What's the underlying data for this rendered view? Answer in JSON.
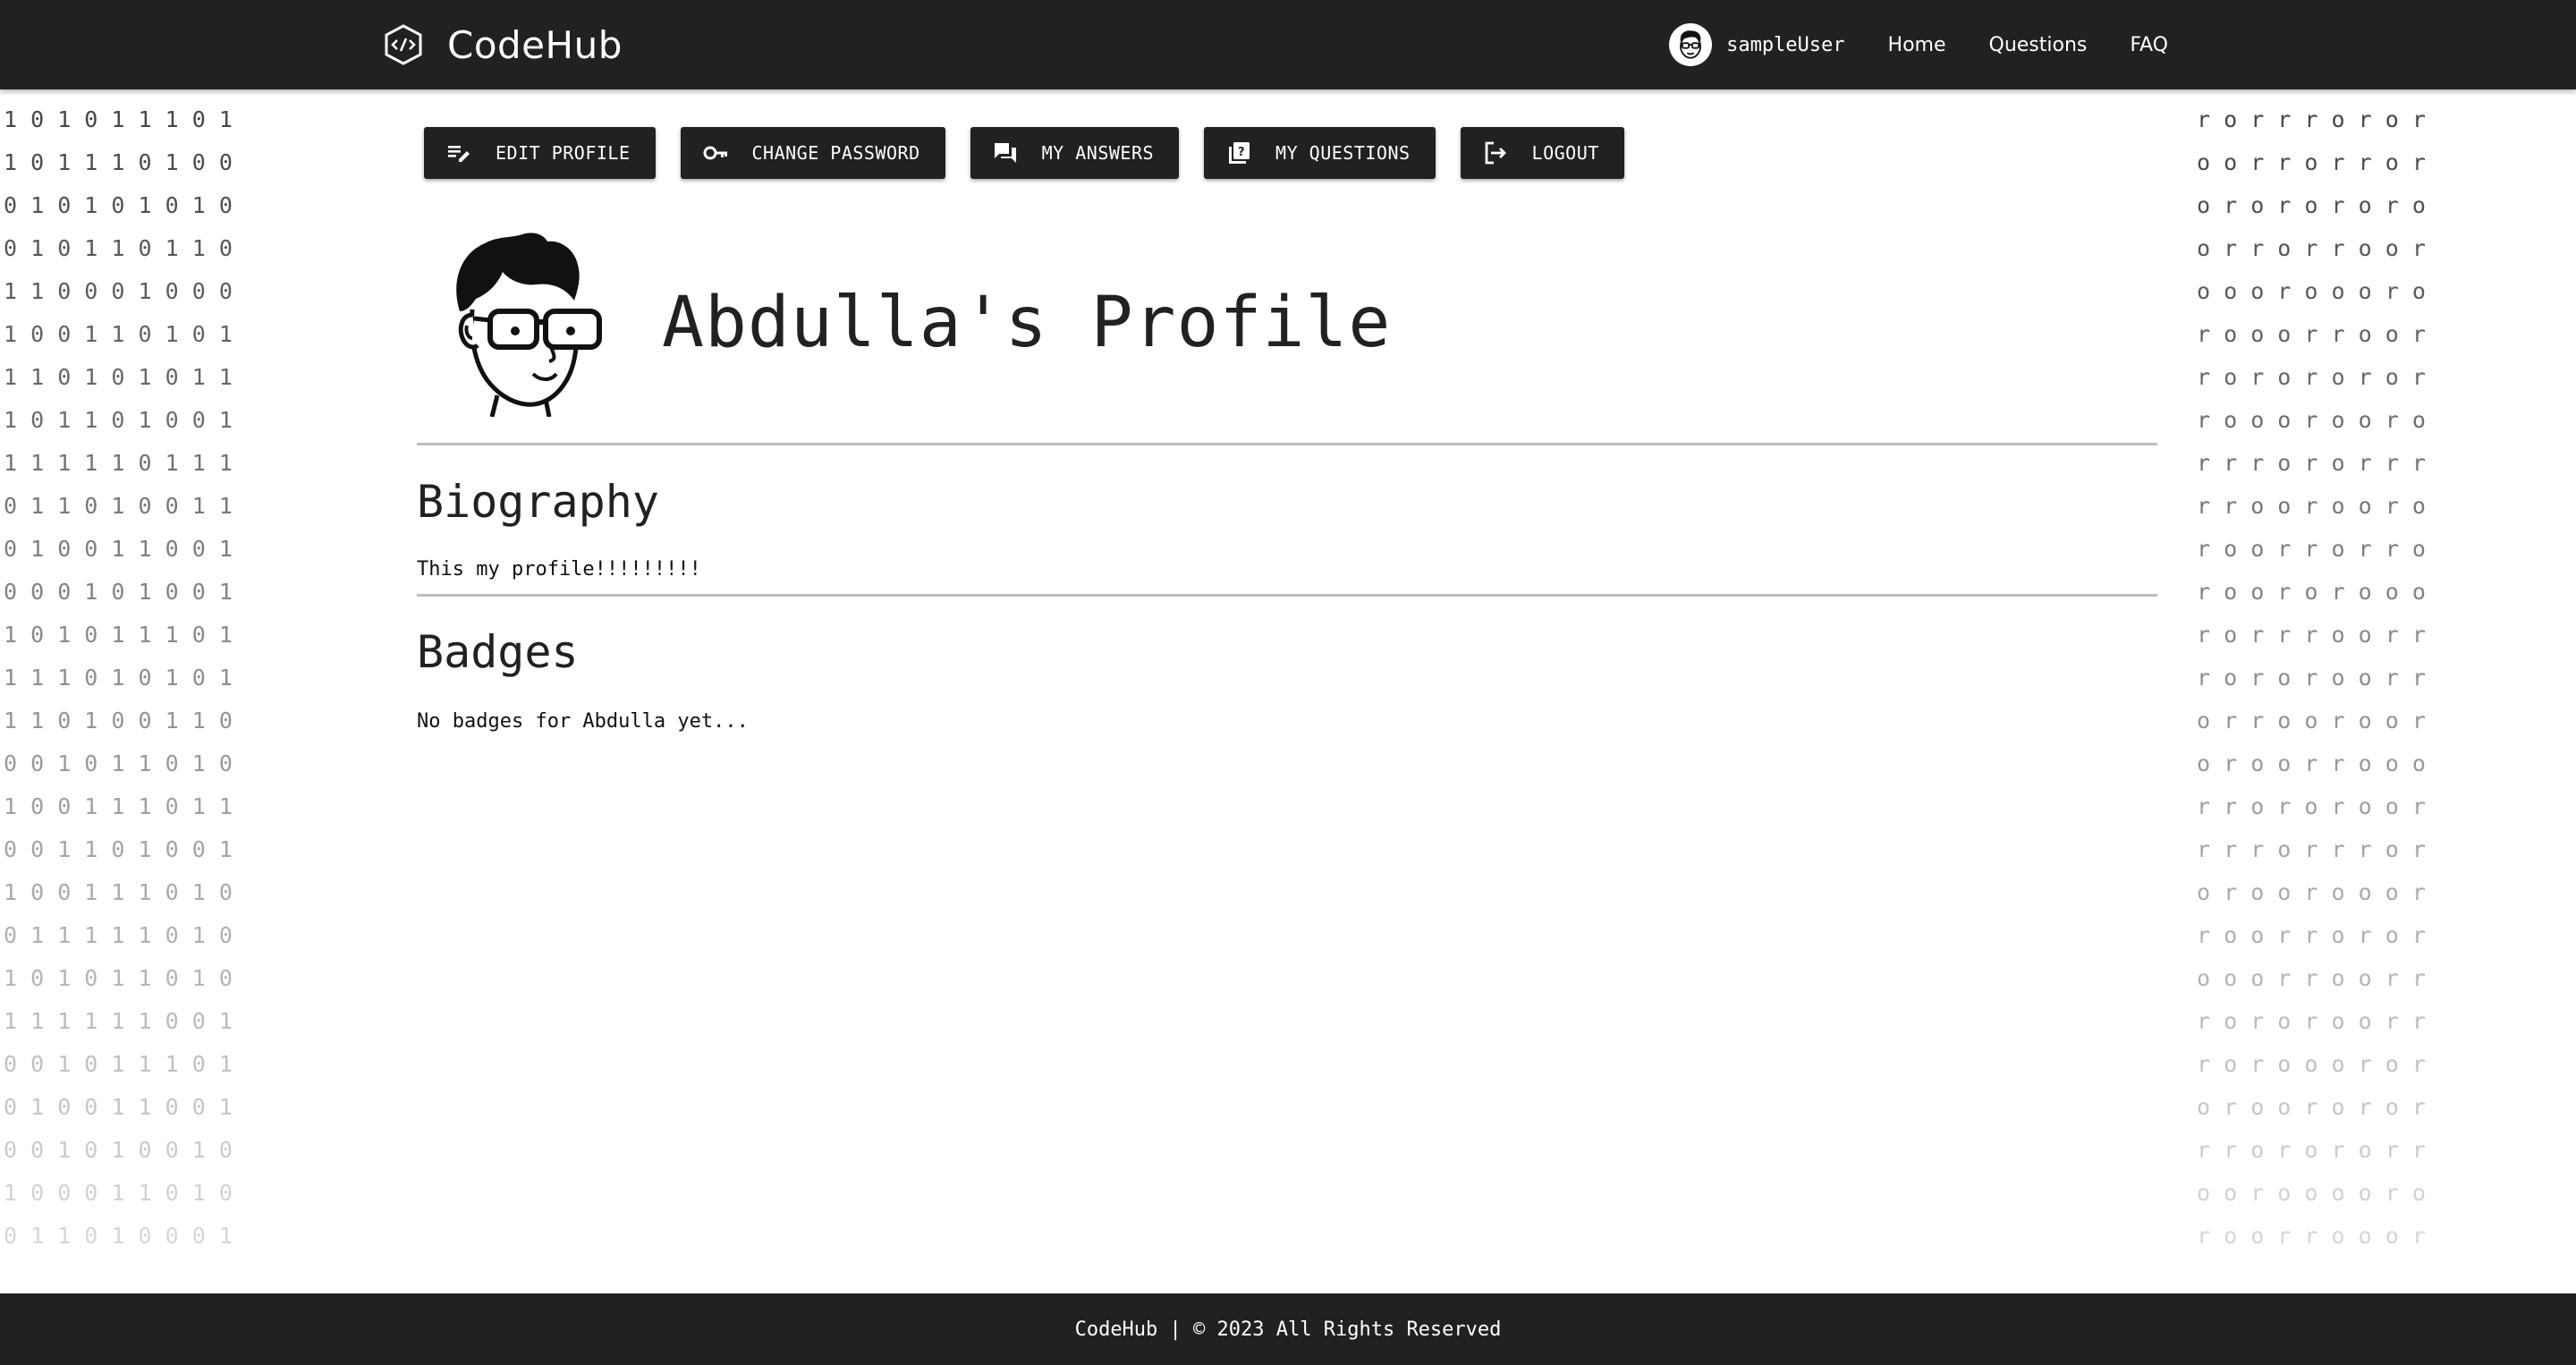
{
  "header": {
    "brand": "CodeHub",
    "user": "sampleUser",
    "nav": [
      "Home",
      "Questions",
      "FAQ"
    ]
  },
  "toolbar": {
    "edit_profile": "EDIT PROFILE",
    "change_password": "CHANGE PASSWORD",
    "my_answers": "MY ANSWERS",
    "my_questions": "MY QUESTIONS",
    "logout": "LOGOUT"
  },
  "profile": {
    "title": "Abdulla's Profile",
    "biography_heading": "Biography",
    "biography_text": "This my profile!!!!!!!!!",
    "badges_heading": "Badges",
    "badges_text": "No badges for Abdulla yet..."
  },
  "background": {
    "left_rows": [
      "1 0 1 0 1 1 1 0 1",
      "1 0 1 1 1 0 1 0 0",
      "0 1 0 1 0 1 0 1 0",
      "0 1 0 1 1 0 1 1 0",
      "1 1 0 0 0 1 0 0 0",
      "1 0 0 1 1 0 1 0 1",
      "1 1 0 1 0 1 0 1 1",
      "1 0 1 1 0 1 0 0 1",
      "1 1 1 1 1 0 1 1 1",
      "0 1 1 0 1 0 0 1 1",
      "0 1 0 0 1 1 0 0 1",
      "0 0 0 1 0 1 0 0 1",
      "1 0 1 0 1 1 1 0 1",
      "1 1 1 0 1 0 1 0 1",
      "1 1 0 1 0 0 1 1 0",
      "0 0 1 0 1 1 0 1 0",
      "1 0 0 1 1 1 0 1 1",
      "0 0 1 1 0 1 0 0 1",
      "1 0 0 1 1 1 0 1 0",
      "0 1 1 1 1 1 0 1 0",
      "1 0 1 0 1 1 0 1 0",
      "1 1 1 1 1 1 0 0 1",
      "0 0 1 0 1 1 1 0 1",
      "0 1 0 0 1 1 0 0 1",
      "0 0 1 0 1 0 0 1 0",
      "1 0 0 0 1 1 0 1 0",
      "0 1 1 0 1 0 0 0 1"
    ],
    "right_rows": [
      "r o r r r o r o r",
      "o o r r o r r o r",
      "o r o r o r o r o",
      "o r r o r r o o r",
      "o o o r o o o r o",
      "r o o o r r o o r",
      "r o r o r o r o r",
      "r o o o r o o r o",
      "r r r o r o r r r",
      "r r o o r o o r o",
      "r o o r r o r r o",
      "r o o r o r o o o",
      "r o r r r o o r r",
      "r o r o r o o r r",
      "o r r o o r o o r",
      "o r o o r r o o o",
      "r r o r o r o o r",
      "r r r o r r r o r",
      "o r o o r o o o r",
      "r o o r r o r o r",
      "o o o r r o o r r",
      "r o r o r o o r r",
      "r o r o o o r o r",
      "o r o o r o r o r",
      "r r o r o r o r r",
      "o o r o o o o r o",
      "r o o r r o o o r"
    ]
  },
  "footer": {
    "text": "CodeHub | © 2023 All Rights Reserved"
  }
}
